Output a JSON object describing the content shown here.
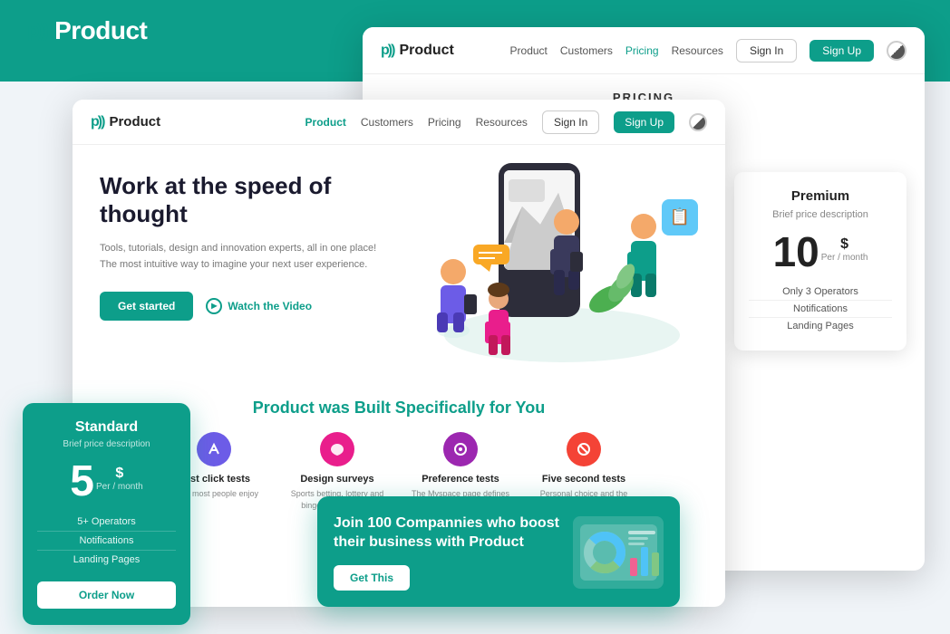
{
  "app": {
    "name": "Product",
    "logo_symbol": "p))"
  },
  "top_logo": {
    "text": "Product"
  },
  "back_browser": {
    "navbar": {
      "logo": "Product",
      "links": [
        "Product",
        "Customers",
        "Pricing",
        "Resources"
      ],
      "signin": "Sign In",
      "signup": "Sign Up"
    },
    "pricing_title": "PRICING",
    "premium_card": {
      "title": "Premium",
      "description": "Brief price description",
      "price_number": "10",
      "price_dollar": "$",
      "price_period": "Per / month",
      "features": [
        "Only 3 Operators",
        "Notifications",
        "Landing Pages"
      ]
    }
  },
  "front_browser": {
    "navbar": {
      "logo": "Product",
      "links": [
        "Product",
        "Customers",
        "Pricing",
        "Resources"
      ],
      "signin": "Sign In",
      "signup": "Sign Up"
    },
    "hero": {
      "title": "Work at the speed of thought",
      "subtitle": "Tools, tutorials, design and innovation experts, all in one place! The most intuitive way to imagine your next user experience.",
      "btn_getstarted": "Get started",
      "btn_watch": "Watch the Video"
    },
    "features_title_pre": "Product",
    "features_title_post": " was Built Specifically for You",
    "features": [
      {
        "name": "First click tests",
        "desc": "While most people enjoy",
        "color": "#6c5ce7",
        "icon": "↗"
      },
      {
        "name": "Design surveys",
        "desc": "Sports betting, lottery and bingo, the individual",
        "color": "#e91e8c",
        "icon": "♥"
      },
      {
        "name": "Preference tests",
        "desc": "The Myspace page defines the individual",
        "color": "#9c27b0",
        "icon": "◈"
      },
      {
        "name": "Five second tests",
        "desc": "Personal choice and the personal capability of the",
        "color": "#f44336",
        "icon": "⊘"
      }
    ]
  },
  "standard_card": {
    "title": "Standard",
    "description": "Brief price description",
    "price_number": "5",
    "price_dollar": "$",
    "price_period": "Per / month",
    "features": [
      "5+ Operators",
      "Notifications",
      "Landing Pages"
    ],
    "btn_order": "Order Now"
  },
  "cta_card": {
    "title": "Join 100 Compannies who boost their business with Product",
    "btn_text": "Get This"
  }
}
